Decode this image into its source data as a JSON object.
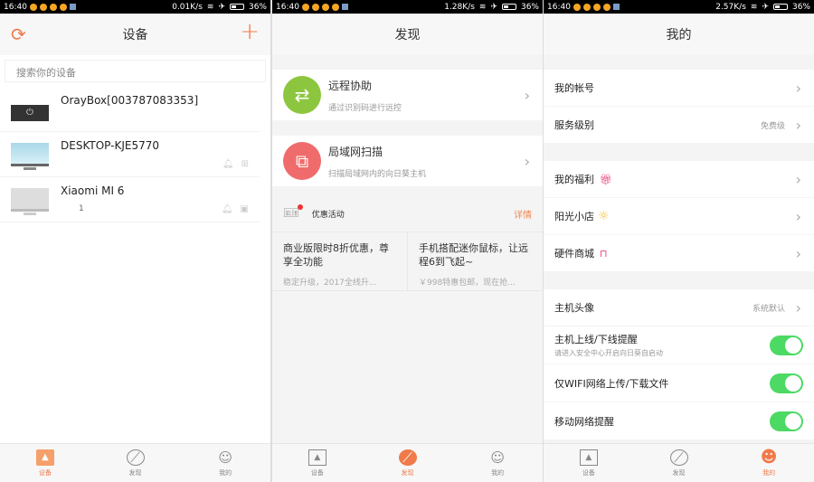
{
  "status": [
    {
      "time": "16:40",
      "speed": "0.01K/s",
      "battery": "36%"
    },
    {
      "time": "16:40",
      "speed": "1.28K/s",
      "battery": "36%"
    },
    {
      "time": "16:40",
      "speed": "2.57K/s",
      "battery": "36%"
    }
  ],
  "devices": {
    "title": "设备",
    "search_placeholder": "搜索你的设备",
    "items": [
      {
        "name": "OrayBox[003787083353]"
      },
      {
        "name": "DESKTOP-KJE5770"
      },
      {
        "name": "Xiaomi MI 6",
        "sub": "1"
      }
    ]
  },
  "discover": {
    "title": "发现",
    "cards": [
      {
        "title": "远程协助",
        "subtitle": "通过识别码进行远控"
      },
      {
        "title": "局域网扫描",
        "subtitle": "扫描局域网内的向日葵主机"
      }
    ],
    "promo_label": "优惠活动",
    "promo_more": "详情",
    "promos": [
      {
        "title": "商业版限时8折优惠，尊享全功能",
        "subtitle": "稳定升级，2017全线升..."
      },
      {
        "title": "手机搭配迷你鼠标，让远程6到飞起~",
        "subtitle": "￥998特惠包邮，现在抢..."
      }
    ]
  },
  "me": {
    "title": "我的",
    "account": "我的帐号",
    "service": "服务级别",
    "service_value": "免费级",
    "welfare": "我的福利",
    "shop": "阳光小店",
    "hardware": "硬件商城",
    "avatar": "主机头像",
    "avatar_value": "系统默认",
    "online": "主机上线/下线提醒",
    "online_sub": "请进入安全中心开启向日葵自启动",
    "wifi": "仅WIFI网络上传/下载文件",
    "mobile": "移动网络提醒",
    "toggles": {
      "online": true,
      "wifi": true,
      "mobile": true
    }
  },
  "nav": {
    "devices": "设备",
    "discover": "发现",
    "me": "我的"
  },
  "colors": {
    "accent": "#f07a4a",
    "toggle": "#4cd964",
    "green": "#8cc63e",
    "red": "#f06b6b"
  }
}
